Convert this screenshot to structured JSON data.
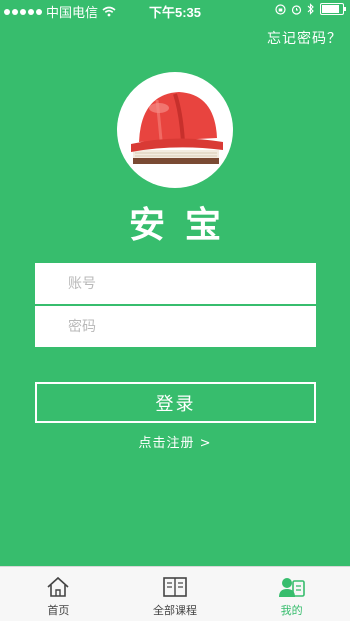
{
  "status_bar": {
    "carrier": "中国电信",
    "time": "下午5:35",
    "battery_level": 0.85,
    "icons": [
      "signal-dots",
      "wifi-icon",
      "rotation-lock-icon",
      "alarm-icon",
      "bluetooth-icon",
      "battery-icon"
    ]
  },
  "header": {
    "forgot_password": "忘记密码？"
  },
  "logo": {
    "icon": "safety-helmet-icon",
    "app_name": "安宝"
  },
  "form": {
    "account_placeholder": "账号",
    "account_value": "",
    "password_placeholder": "密码",
    "password_value": "",
    "login_label": "登录",
    "register_label": "点击注册 >"
  },
  "tabs": [
    {
      "label": "首页",
      "icon": "home-icon",
      "active": false
    },
    {
      "label": "全部课程",
      "icon": "book-icon",
      "active": false
    },
    {
      "label": "我的",
      "icon": "profile-card-icon",
      "active": true
    }
  ],
  "colors": {
    "background": "#37bd6d",
    "accent": "#37bd6d",
    "helmet": "#e8443f",
    "tab_bar": "#f7f7f7"
  }
}
